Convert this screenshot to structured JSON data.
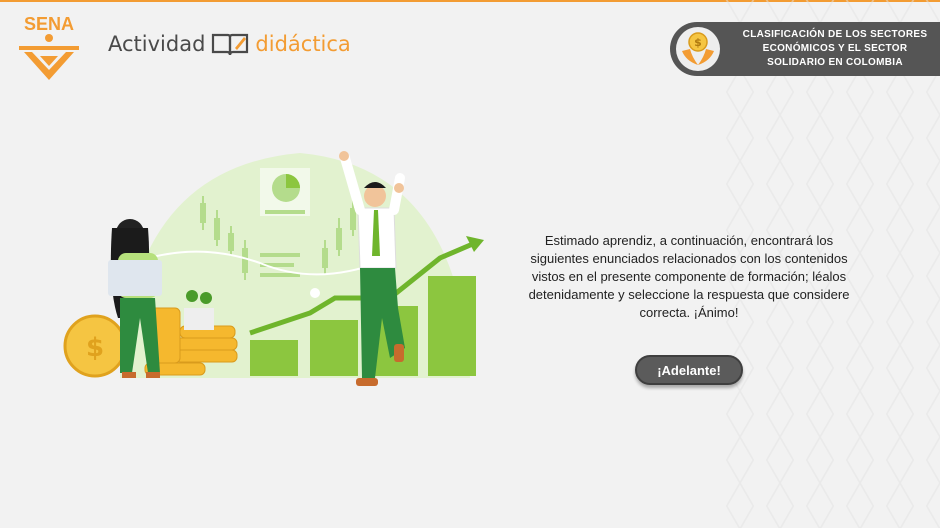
{
  "header": {
    "logo_text": "SENA",
    "brand_prefix": "Actividad",
    "brand_suffix": "didáctica",
    "accent_color": "#f39c33"
  },
  "badge": {
    "line1": "CLASIFICACIÓN DE LOS SECTORES",
    "line2": "ECONÓMICOS Y EL SECTOR",
    "line3": "SOLIDARIO EN COLOMBIA",
    "icon": "hands-coin-icon"
  },
  "main": {
    "message": "Estimado aprendiz, a continuación, encontrará los siguientes enunciados relacionados con los contenidos vistos en el presente componente de formación; léalos detenidamente y seleccione la respuesta que considere correcta. ¡Ánimo!",
    "button_label": "¡Adelante!"
  }
}
